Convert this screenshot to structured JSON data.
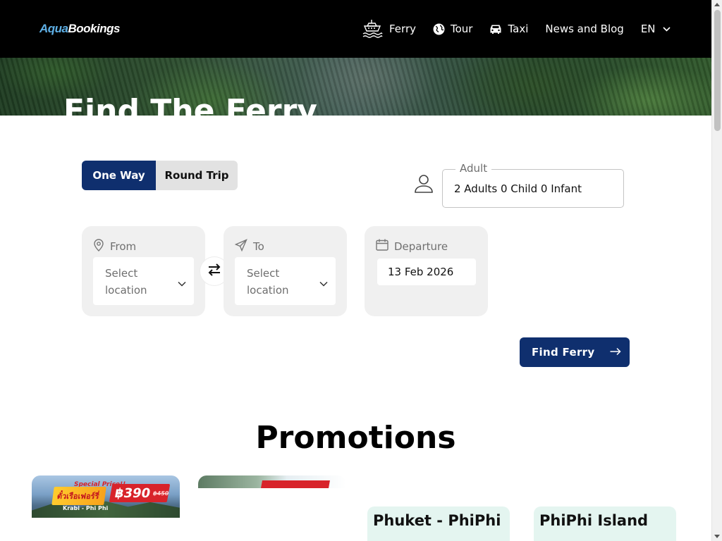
{
  "brand": {
    "logo_part1": "Aqua",
    "logo_part2": "Bookings"
  },
  "nav": {
    "ferry": "Ferry",
    "tour": "Tour",
    "taxi": "Taxi",
    "blog": "News and Blog",
    "language": "EN"
  },
  "hero": {
    "title": "Find The Ferry"
  },
  "trip_type": {
    "one_way": "One Way",
    "round_trip": "Round Trip",
    "selected": "One Way"
  },
  "passengers": {
    "label": "Adult",
    "value": "2 Adults 0 Child 0 Infant"
  },
  "from": {
    "label": "From",
    "placeholder": "Select location"
  },
  "to": {
    "label": "To",
    "placeholder": "Select location"
  },
  "departure": {
    "label": "Departure",
    "value": "13 Feb 2026"
  },
  "search": {
    "button_label": "Find Ferry"
  },
  "promotions": {
    "heading": "Promotions",
    "banner1": {
      "tag": "Special Price!!",
      "headline": "ตั๋วเรือเฟอร์รี่",
      "route": "Krabi - Phi Phi",
      "price": "฿390",
      "old_price": "฿450"
    },
    "cards": [
      {
        "title": "Phuket - PhiPhi"
      },
      {
        "title": "PhiPhi Island"
      }
    ]
  },
  "colors": {
    "primary": "#0f2f6e",
    "header_bg": "#000000",
    "card_bg": "#f0f0f0",
    "promo_card_bg": "#e4f5f0",
    "logo_accent": "#5fb0e6"
  },
  "icons": [
    "ferry-icon",
    "globe-icon",
    "car-icon",
    "chevron-down-icon",
    "person-icon",
    "map-pin-icon",
    "send-icon",
    "calendar-icon",
    "swap-icon",
    "arrow-right-icon"
  ]
}
